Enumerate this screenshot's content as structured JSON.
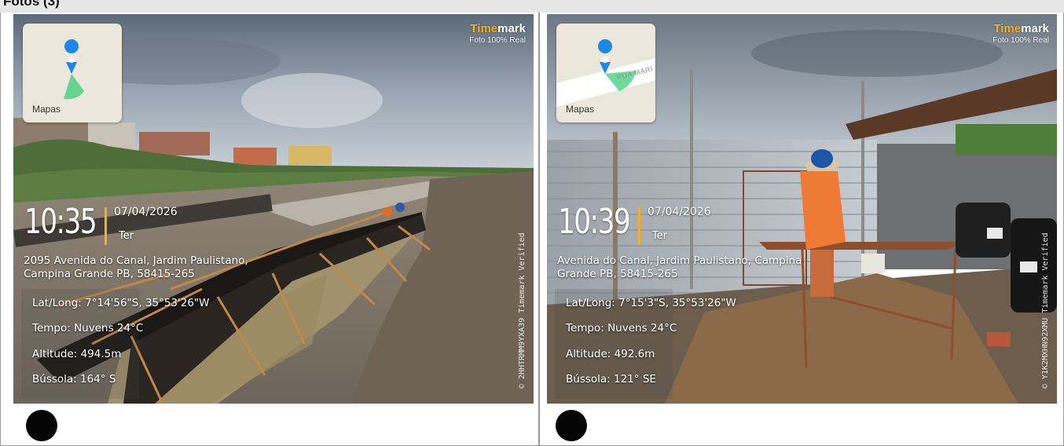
{
  "header": {
    "title": "Fotos (3)"
  },
  "cards": [
    {
      "brand_prefix": "Time",
      "brand_suffix": "mark",
      "brand_sub": "Foto 100% Real",
      "map_label": "Mapas",
      "map_street": "",
      "time": "10:35",
      "date": "07/04/2026",
      "day": "Ter",
      "address": "2095 Avenida do Canal, Jardim Paulistano, Campina Grande PB, 58415-265",
      "latlong": "Lat/Long: 7°14'56\"S, 35°53'26\"W",
      "weather": "Tempo: Nuvens 24°C",
      "altitude": "Altitude: 494.5m",
      "compass": "Bússola: 164° S",
      "verification": "© 2HHTRMM9YXA39  Timemark Verified"
    },
    {
      "brand_prefix": "Time",
      "brand_suffix": "mark",
      "brand_sub": "Foto 100% Real",
      "map_label": "Mapas",
      "map_street": "RUA MARI",
      "time": "10:39",
      "date": "07/04/2026",
      "day": "Ter",
      "address": "Avenida do Canal, Jardim Paulistano, Campina Grande PB, 58415-265",
      "latlong": "Lat/Long: 7°15'3\"S, 35°53'26\"W",
      "weather": "Tempo: Nuvens 24°C",
      "altitude": "Altitude: 492.6m",
      "compass": "Bússola: 121° SE",
      "verification": "© Y1K2MXHN92XMU  Timemark Verified"
    }
  ],
  "colors": {
    "accent": "#f5b021",
    "pin": "#1e88e5",
    "bearing": "#2ecc71"
  }
}
